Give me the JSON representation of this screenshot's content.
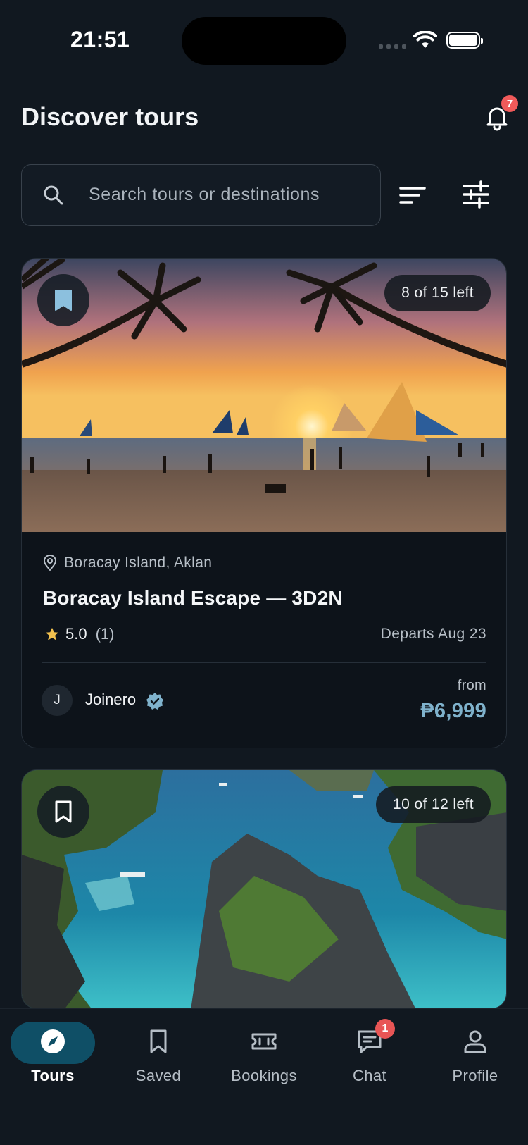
{
  "status_bar": {
    "time": "21:51"
  },
  "header": {
    "title": "Discover tours",
    "notification_count": "7"
  },
  "search": {
    "placeholder": "Search tours or destinations",
    "value": ""
  },
  "tours": [
    {
      "seats_left": "8 of 15 left",
      "saved": true,
      "location": "Boracay Island, Aklan",
      "title": "Boracay Island Escape — 3D2N",
      "rating": "5.0",
      "rating_count": "(1)",
      "departs": "Departs Aug 23",
      "host_initial": "J",
      "host_name": "Joinero",
      "price_label": "from",
      "price": "₱6,999"
    },
    {
      "seats_left": "10 of 12 left",
      "saved": false
    }
  ],
  "bottom_nav": {
    "items": [
      {
        "label": "Tours",
        "icon": "compass-icon",
        "active": true
      },
      {
        "label": "Saved",
        "icon": "bookmark-icon"
      },
      {
        "label": "Bookings",
        "icon": "ticket-icon"
      },
      {
        "label": "Chat",
        "icon": "chat-icon",
        "badge": "1"
      },
      {
        "label": "Profile",
        "icon": "person-icon"
      }
    ]
  },
  "colors": {
    "background": "#111820",
    "accent": "#7fb2cc",
    "active_nav": "#0f4f66",
    "badge": "#f05a5a",
    "star": "#f2c14e"
  }
}
